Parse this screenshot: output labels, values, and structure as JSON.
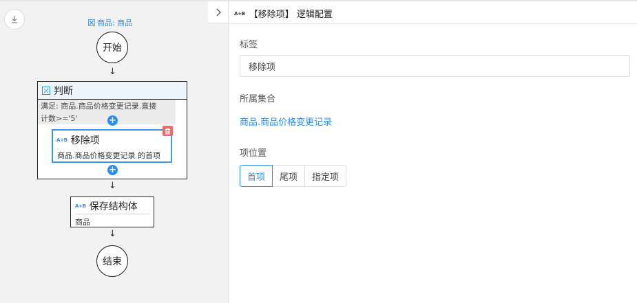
{
  "flow": {
    "title": "商品: 商品",
    "start_label": "开始",
    "end_label": "结束",
    "judge_title": "判断",
    "judge_condition_line1": "满足: 商品.商品价格变更记录.直接",
    "judge_condition_line2": "计数>='5'",
    "remove_title": "移除项",
    "remove_desc": "商品.商品价格变更记录 的首项",
    "save_title": "保存结构体",
    "save_desc": "商品",
    "arrow": "↓",
    "plus": "+"
  },
  "panel": {
    "title": "【移除项】 逻辑配置",
    "label_field": "标签",
    "label_value": "移除项",
    "collection_field": "所属集合",
    "collection_value": "商品.商品价格变更记录",
    "position_field": "项位置",
    "position_options": [
      "首项",
      "尾项",
      "指定项"
    ],
    "position_selected": "首项"
  },
  "icons": {
    "ab_text": "A+B",
    "collapse": "chevron-right-icon",
    "download": "download-icon"
  },
  "colors": {
    "accent": "#2d8cf0",
    "delete": "#ef6b6b"
  }
}
